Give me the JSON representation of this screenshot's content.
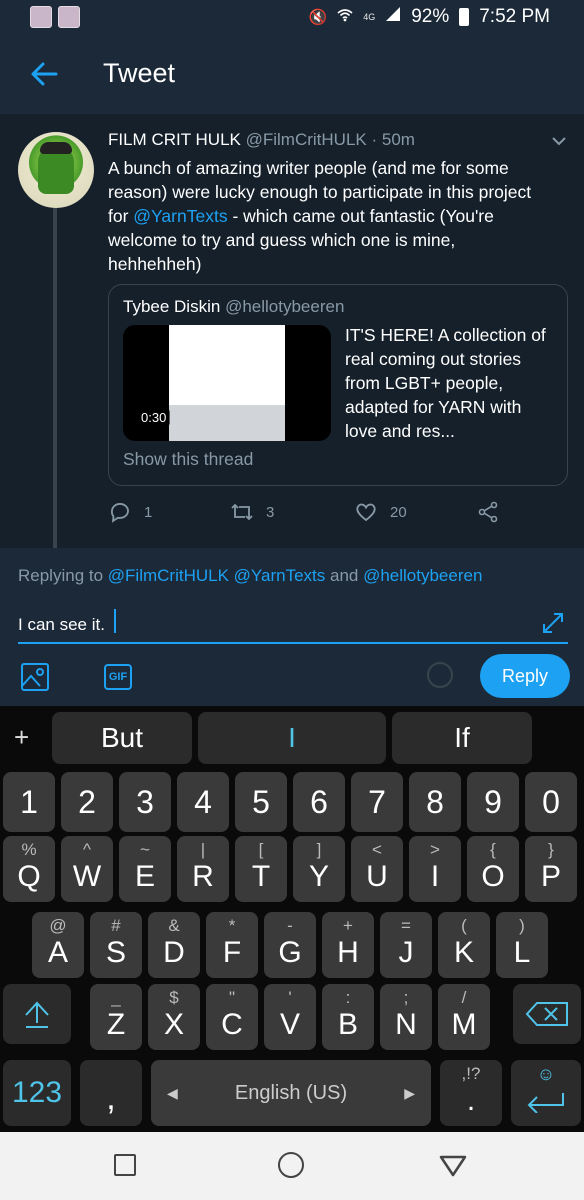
{
  "status_bar": {
    "network_label": "4G",
    "battery": "92%",
    "time": "7:52 PM"
  },
  "header": {
    "title": "Tweet"
  },
  "tweet": {
    "author_name": "FILM CRIT HULK",
    "author_handle": "@FilmCritHULK",
    "time_ago": "· 50m",
    "text_before": "A bunch of amazing writer people (and me for some reason) were lucky enough to participate in this project for ",
    "mention": "@YarnTexts",
    "text_after": " - which came out fantastic (You're welcome to try and guess which one is mine, hehhehheh)",
    "quote": {
      "author_name": "Tybee Diskin",
      "author_handle": "@hellotybeeren",
      "video_duration": "0:30",
      "text": "IT'S HERE! A collection of real coming out stories from LGBT+ people, adapted for YARN with love and res...",
      "show_thread": "Show this thread"
    },
    "actions": {
      "replies": "1",
      "retweets": "3",
      "likes": "20"
    }
  },
  "reply": {
    "replying_prefix": "Replying to ",
    "replying_to": [
      "@FilmCritHULK",
      "@YarnTexts"
    ],
    "replying_and": " and ",
    "replying_last": "@hellotybeeren",
    "input_value": "I can see it.",
    "gif_label": "GIF",
    "button_label": "Reply"
  },
  "keyboard": {
    "plus": "+",
    "suggestions": [
      "But",
      "I",
      "If"
    ],
    "number_row": [
      "1",
      "2",
      "3",
      "4",
      "5",
      "6",
      "7",
      "8",
      "9",
      "0"
    ],
    "row1": [
      {
        "k": "Q",
        "s": "%"
      },
      {
        "k": "W",
        "s": "^"
      },
      {
        "k": "E",
        "s": "~"
      },
      {
        "k": "R",
        "s": "|"
      },
      {
        "k": "T",
        "s": "["
      },
      {
        "k": "Y",
        "s": "]"
      },
      {
        "k": "U",
        "s": "<"
      },
      {
        "k": "I",
        "s": ">"
      },
      {
        "k": "O",
        "s": "{"
      },
      {
        "k": "P",
        "s": "}"
      }
    ],
    "row2": [
      {
        "k": "A",
        "s": "@"
      },
      {
        "k": "S",
        "s": "#"
      },
      {
        "k": "D",
        "s": "&"
      },
      {
        "k": "F",
        "s": "*"
      },
      {
        "k": "G",
        "s": "-"
      },
      {
        "k": "H",
        "s": "+"
      },
      {
        "k": "J",
        "s": "="
      },
      {
        "k": "K",
        "s": "("
      },
      {
        "k": "L",
        "s": ")"
      }
    ],
    "row3": [
      {
        "k": "Z",
        "s": "_"
      },
      {
        "k": "X",
        "s": "$"
      },
      {
        "k": "C",
        "s": "\""
      },
      {
        "k": "V",
        "s": "'"
      },
      {
        "k": "B",
        "s": ":"
      },
      {
        "k": "N",
        "s": ";"
      },
      {
        "k": "M",
        "s": "/"
      }
    ],
    "symbols_key": "123",
    "comma": ",",
    "space_label": "English (US)",
    "period": ".",
    "period_sec": ",!?"
  },
  "colors": {
    "accent": "#1da1f2",
    "background": "#15202b",
    "header": "#1c2938",
    "muted": "#8899a6"
  }
}
